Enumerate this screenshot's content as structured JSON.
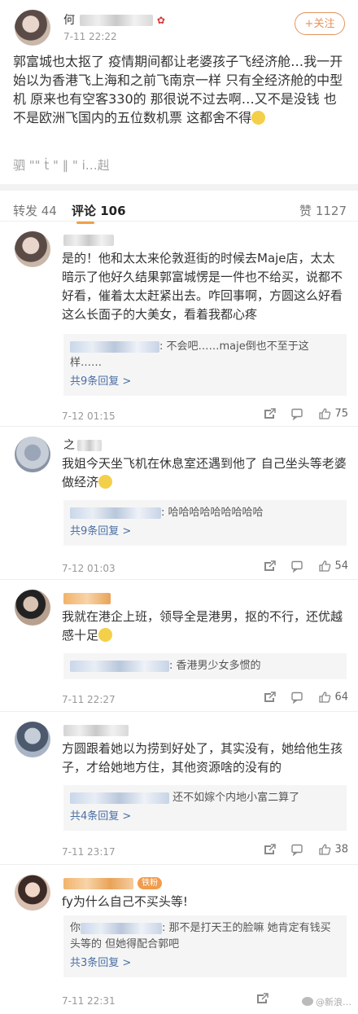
{
  "post": {
    "author_name": "何",
    "time": "7-11 22:22",
    "follow_label": "+关注",
    "text": "郭富城也太抠了 疫情期间都让老婆孩子飞经济舱…我一开始以为香港飞上海和之前飞南京一样 只有全经济舱的中型机 原来也有空客330的 那很说不过去啊…又不是没钱 也不是欧洲飞国内的五位数机票 这都舍不得",
    "trailing_text": "驷  \"\"  ṫ  \"  ∥  \"  i…赳"
  },
  "tabs": {
    "reposts": "转发 44",
    "comments": "评论 106",
    "likes": "赞 1127"
  },
  "comments": [
    {
      "text": "是的！他和太太来伦敦逛街的时候去Maje店，太太暗示了他好久结果郭富城愣是一件也不给买，说都不好看，催着太太赶紧出去。咋回事啊，方圆这么好看这么长面子的大美女，看着我都心疼",
      "reply": ": 不会吧……maje倒也不至于这样……",
      "reply_more": "共9条回复 >",
      "time": "7-12 01:15",
      "likes": "75"
    },
    {
      "name": "之",
      "text": "我姐今天坐飞机在休息室还遇到他了 自己坐头等老婆做经济",
      "reply": ": 哈哈哈哈哈哈哈哈哈",
      "reply_more": "共9条回复 >",
      "time": "7-12 01:03",
      "likes": "54"
    },
    {
      "text": "我就在港企上班，领导全是港男，抠的不行，还优越感十足",
      "reply": ": 香港男少女多惯的",
      "time": "7-11 22:27",
      "likes": "64"
    },
    {
      "text": "方圆跟着她以为捞到好处了，其实没有，她给他生孩子，才给她地方住，其他资源啥的没有的",
      "reply": "还不如嫁个内地小富二算了",
      "reply_more": "共4条回复 >",
      "time": "7-11 23:17",
      "likes": "38"
    },
    {
      "badge": "铁粉",
      "text": "fy为什么自己不买头等!",
      "reply_prefix": "你",
      "reply": ": 那不是打天王的脸嘛 她肯定有钱买头等的 但她得配合郭吧",
      "reply_more": "共3条回复 >",
      "time": "7-11 22:31",
      "likes": ""
    }
  ],
  "watermark": "@新浪…"
}
